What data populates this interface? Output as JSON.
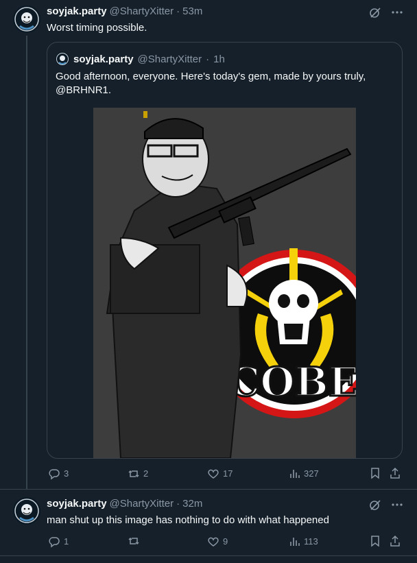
{
  "tweets": [
    {
      "name": "soyjak.party",
      "handle": "@ShartyXitter",
      "dot": "·",
      "time": "53m",
      "text": "Worst timing possible.",
      "quote": {
        "name": "soyjak.party",
        "handle": "@ShartyXitter",
        "dot": "·",
        "time": "1h",
        "text": "Good afternoon, everyone. Here's today's gem, made by yours truly, @BRHNR1.",
        "image_text": "COBE"
      },
      "actions": {
        "replies": "3",
        "reposts": "2",
        "likes": "17",
        "views": "327"
      }
    },
    {
      "name": "soyjak.party",
      "handle": "@ShartyXitter",
      "dot": "·",
      "time": "32m",
      "text": "man shut up this image has nothing to do with what happened",
      "actions": {
        "replies": "1",
        "reposts": "",
        "likes": "9",
        "views": "113"
      }
    }
  ],
  "icons": {
    "more": "more-horizontal-icon",
    "grok": "grok-icon",
    "reply": "reply-icon",
    "repost": "repost-icon",
    "like": "heart-icon",
    "views": "analytics-icon",
    "bookmark": "bookmark-icon",
    "share": "share-icon"
  },
  "colors": {
    "background": "#15202b",
    "border": "#38444d",
    "secondary_text": "#8b98a5",
    "primary_text": "#f7f9f9"
  }
}
